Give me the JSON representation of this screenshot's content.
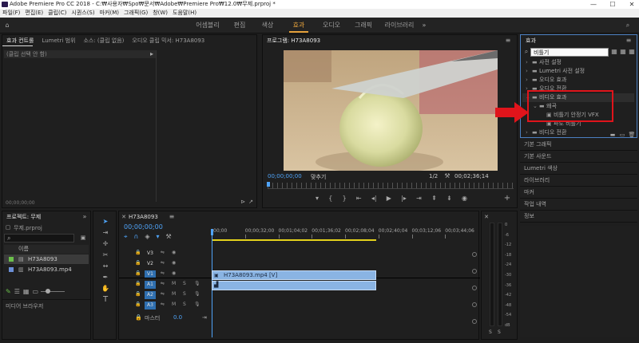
{
  "window": {
    "title": "Adobe Premiere Pro CC 2018 - C:₩사용자₩Spo₩문서₩Adobe₩Premiere Pro₩12.0₩무제.prproj *",
    "min": "—",
    "max": "☐",
    "close": "✕"
  },
  "menu": [
    "파일(F)",
    "편집(E)",
    "클립(C)",
    "시퀀스(S)",
    "마커(M)",
    "그래픽(G)",
    "창(W)",
    "도움말(H)"
  ],
  "workspaces": [
    "어셈블리",
    "편집",
    "색상",
    "효과",
    "오디오",
    "그래픽",
    "라이브러리"
  ],
  "active_workspace": "효과",
  "source_panel": {
    "tabs": [
      "효과 컨트롤",
      "Lumetri 범위",
      "소스: (클립 없음)",
      "오디오 클립 믹서: H73A8093"
    ],
    "clip_label": "(클립 선택 안 함)",
    "timecode": "00;00;00;00"
  },
  "program": {
    "title": "프로그램: H73A8093",
    "timecode": "00;00;00;00",
    "fit": "맞추기",
    "scale": "1/2",
    "duration": "00;02;36;14"
  },
  "effects": {
    "title": "효과",
    "search_value": "비틀기",
    "tree": [
      {
        "label": "사전 설정",
        "level": 0,
        "expanded": false
      },
      {
        "label": "Lumetri 사전 설정",
        "level": 0,
        "expanded": false
      },
      {
        "label": "오디오 효과",
        "level": 0,
        "expanded": false
      },
      {
        "label": "오디오 전환",
        "level": 0,
        "expanded": false
      },
      {
        "label": "비디오 효과",
        "level": 0,
        "expanded": true
      },
      {
        "label": "왜곡",
        "level": 1,
        "expanded": true
      },
      {
        "label": "비틀기 안정기 VFX",
        "level": 2
      },
      {
        "label": "파도 비틀기",
        "level": 2
      },
      {
        "label": "비디오 전환",
        "level": 0,
        "expanded": false
      }
    ],
    "collapsed_panels": [
      "기본 그래픽",
      "기본 사운드",
      "Lumetri 색상",
      "라이브러리",
      "마커",
      "작업 내역",
      "정보"
    ]
  },
  "annotation": {
    "highlight_color": "#e0141b"
  },
  "project": {
    "title": "프로젝트: 무제",
    "file": "무제.prproj",
    "column": "이름",
    "items": [
      {
        "name": "H73A8093",
        "color": "#6bc04b"
      },
      {
        "name": "H73A8093.mp4",
        "color": "#6b8fd6"
      }
    ],
    "media_browser": "미디어 브라우저"
  },
  "timeline": {
    "sequence": "H73A8093",
    "timecode": "00;00;00;00",
    "ruler": [
      ":00;00",
      "00;00;32;00",
      "00;01;04;02",
      "00;01;36;02",
      "00;02;08;04",
      "00;02;40;04",
      "00;03;12;06",
      "00;03;44;06"
    ],
    "video_tracks": [
      "V3",
      "V2",
      "V1"
    ],
    "audio_tracks": [
      "A1",
      "A2",
      "A3"
    ],
    "master": "마스터",
    "master_value": "0.0",
    "clip_video": "H73A8093.mp4 [V]",
    "audio_icon": "▟"
  },
  "meter": {
    "scale": [
      "0",
      "-6",
      "-12",
      "-18",
      "-24",
      "-30",
      "-36",
      "-42",
      "-48",
      "-54",
      "dB"
    ],
    "solo": "S",
    "solo2": "S"
  }
}
